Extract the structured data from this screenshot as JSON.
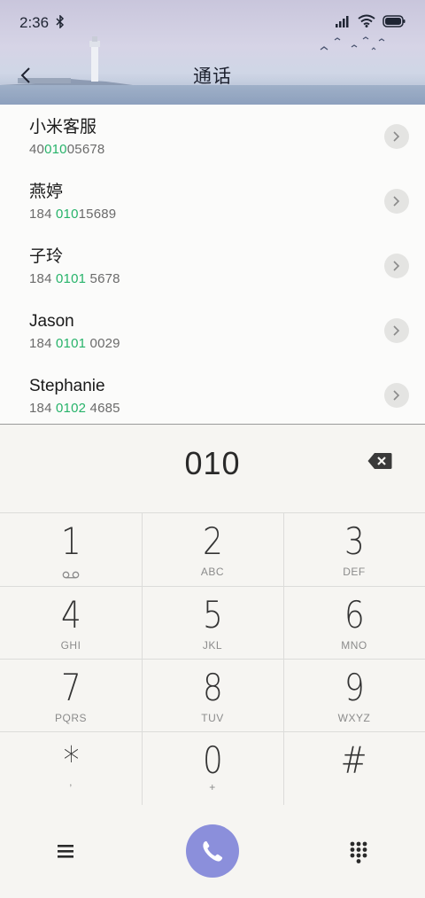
{
  "status_bar": {
    "time": "2:36",
    "bluetooth_icon": "bluetooth-icon",
    "signal_icon": "signal-icon",
    "wifi_icon": "wifi-icon",
    "battery_icon": "battery-icon"
  },
  "header": {
    "title": "通话",
    "back_icon": "back-arrow-icon"
  },
  "results": [
    {
      "name": "小米客服",
      "number_pre": "40",
      "number_match": "010",
      "number_post": "05678"
    },
    {
      "name": "燕婷",
      "number_pre": "184 ",
      "number_match": "010",
      "number_post": "15689"
    },
    {
      "name": "子玲",
      "number_pre": "184 ",
      "number_match": "0101",
      "number_post": " 5678"
    },
    {
      "name": "Jason",
      "number_pre": "184 ",
      "number_match": "0101",
      "number_post": " 0029"
    },
    {
      "name": "Stephanie",
      "number_pre": "184 ",
      "number_match": "0102",
      "number_post": " 4685"
    }
  ],
  "dial": {
    "number": "010",
    "backspace_icon": "backspace-icon"
  },
  "keypad": {
    "keys": [
      {
        "digit": "1",
        "letters": "",
        "sub_icon": "voicemail-icon"
      },
      {
        "digit": "2",
        "letters": "ABC"
      },
      {
        "digit": "3",
        "letters": "DEF"
      },
      {
        "digit": "4",
        "letters": "GHI"
      },
      {
        "digit": "5",
        "letters": "JKL"
      },
      {
        "digit": "6",
        "letters": "MNO"
      },
      {
        "digit": "7",
        "letters": "PQRS"
      },
      {
        "digit": "8",
        "letters": "TUV"
      },
      {
        "digit": "9",
        "letters": "WXYZ"
      },
      {
        "digit": "*",
        "letters": ","
      },
      {
        "digit": "0",
        "letters": "+"
      },
      {
        "digit": "#",
        "letters": ""
      }
    ]
  },
  "action_bar": {
    "menu_icon": "menu-icon",
    "call_icon": "phone-icon",
    "keypad_icon": "dialpad-icon",
    "call_color": "#8b8fdb"
  },
  "colors": {
    "match_highlight": "#27b36a"
  }
}
